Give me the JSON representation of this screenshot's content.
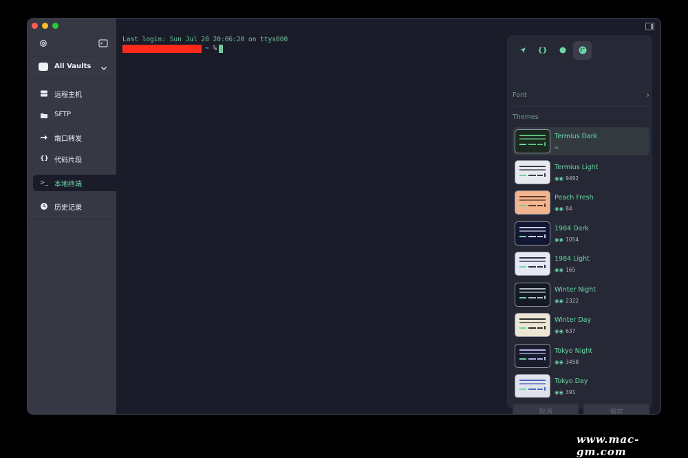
{
  "sidebar": {
    "settings_icon": "gear-icon",
    "terminal_icon": "terminal-icon",
    "vault": {
      "label": "All Vaults",
      "icon": "vault-icon"
    },
    "items": [
      {
        "label": "远程主机",
        "icon": "server-icon"
      },
      {
        "label": "SFTP",
        "icon": "folder-icon"
      },
      {
        "label": "端口转发",
        "icon": "arrow-right-icon"
      },
      {
        "label": "代码片段",
        "icon": "braces-icon"
      },
      {
        "label": "本地终端",
        "icon": "terminal-prompt-icon",
        "active": true
      },
      {
        "label": "历史记录",
        "icon": "clock-icon"
      }
    ]
  },
  "terminal": {
    "last_login": "Last login: Sun Jul 28 20:06:20 on ttys000",
    "prompt_tail": "~ %"
  },
  "panel": {
    "tabs": [
      "rocket-icon",
      "braces-icon",
      "circle-icon",
      "palette-icon"
    ],
    "font_label": "Font",
    "themes_label": "Themes",
    "themes": [
      {
        "name": "Termius Dark",
        "meta": "∞",
        "bg": "#1d2a22",
        "bar": "#5bbf7a",
        "selected": true
      },
      {
        "name": "Termius Light",
        "meta": "9492",
        "bg": "#e7e9ee",
        "bar": "#3a3d4a"
      },
      {
        "name": "Peach Fresh",
        "meta": "84",
        "bg": "#f2b48e",
        "bar": "#5a3a2a"
      },
      {
        "name": "1984 Dark",
        "meta": "1054",
        "bg": "#121734",
        "bar": "#c9cbe0"
      },
      {
        "name": "1984 Light",
        "meta": "165",
        "bg": "#e6e8f3",
        "bar": "#2a2c46"
      },
      {
        "name": "Winter Night",
        "meta": "2322",
        "bg": "#141a24",
        "bar": "#b9bdc8"
      },
      {
        "name": "Winter Day",
        "meta": "637",
        "bg": "#eee6d5",
        "bar": "#2a2a2a"
      },
      {
        "name": "Tokyo Night",
        "meta": "3458",
        "bg": "#1a1b2c",
        "bar": "#b2b6e6"
      },
      {
        "name": "Tokyo Day",
        "meta": "391",
        "bg": "#e1e3ec",
        "bar": "#4a67c2"
      }
    ],
    "cancel_label": "取消",
    "save_label": "保存"
  },
  "watermark": "www.mac-gm.com"
}
